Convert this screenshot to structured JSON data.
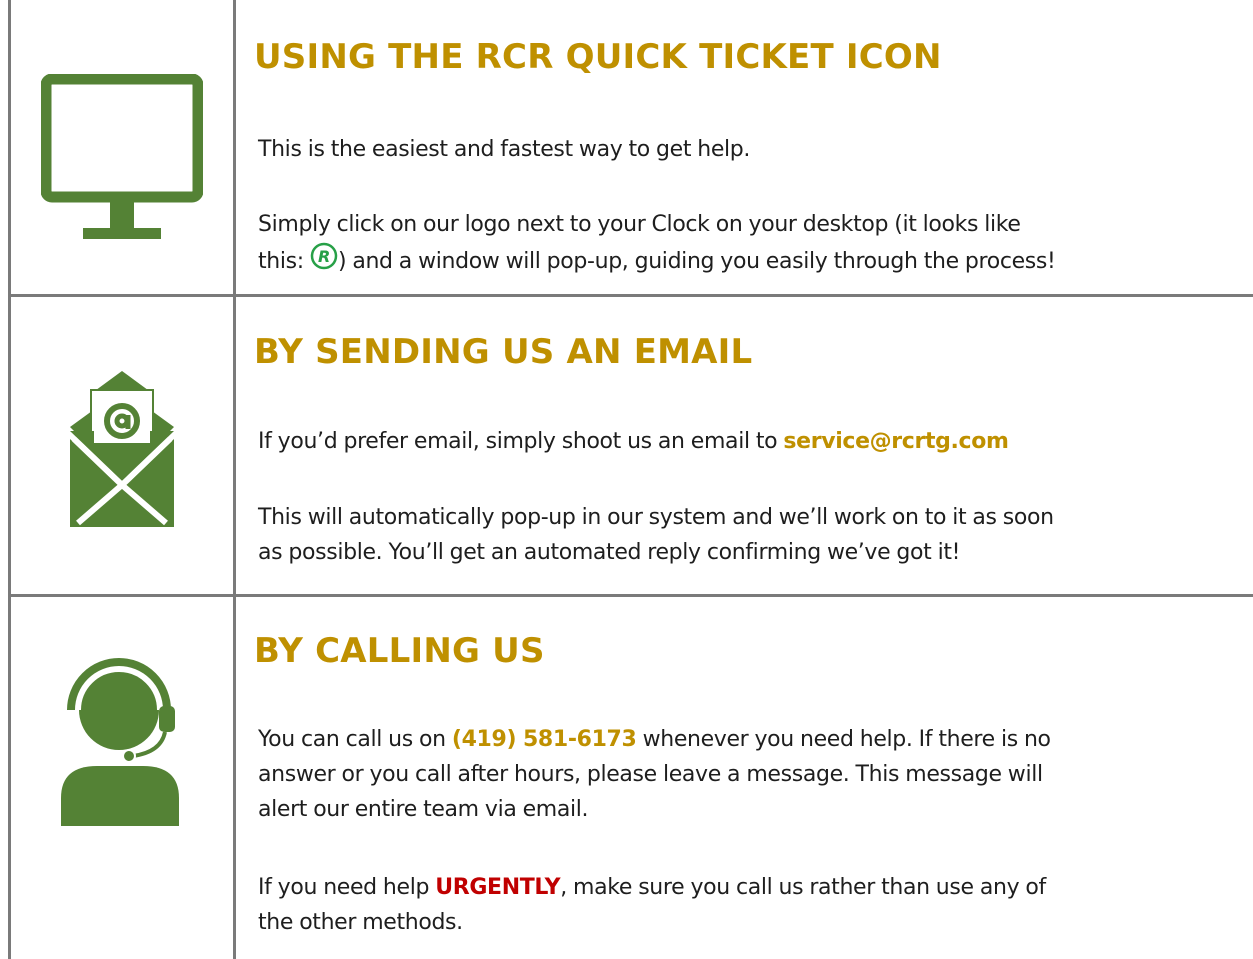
{
  "sections": [
    {
      "icon": "monitor-icon",
      "title": "USING THE RCR QUICK TICKET ICON",
      "paragraph1": "This is the easiest and fastest way to get help.",
      "paragraph2_line1": "Simply click on our logo next to your Clock on your desktop (it looks like",
      "paragraph2_before_logo": "this: ",
      "logo_letter": "R",
      "paragraph2_after_logo": ") and a window will pop-up, guiding you easily through the process!"
    },
    {
      "icon": "email-envelope-icon",
      "title": "BY SENDING US AN EMAIL",
      "paragraph1_before": "If you’d prefer email, simply shoot us an email to ",
      "email": "service@rcrtg.com",
      "paragraph2_line1": "This will automatically pop-up in our system and we’ll work on to it as soon",
      "paragraph2_line2": "as possible. You’ll get an automated reply confirming we’ve got it!"
    },
    {
      "icon": "support-agent-headset-icon",
      "title": "BY CALLING US",
      "paragraph1_before": "You can call us on ",
      "phone": "(419) 581-6173",
      "paragraph1_after": " whenever you need help. If there is no",
      "paragraph1_line2": "answer or you call after hours, please leave a message. This message will",
      "paragraph1_line3": "alert our entire team via email.",
      "paragraph2_before": "If you need help ",
      "urgent": "URGENTLY",
      "paragraph2_after": ", make sure you call us rather than use any of",
      "paragraph2_line2": "the other methods."
    }
  ],
  "colors": {
    "icon_green": "#548235",
    "heading_gold": "#bf9000",
    "urgent_red": "#c00000",
    "border_gray": "#7a7a7a",
    "logo_green": "#27a047"
  }
}
